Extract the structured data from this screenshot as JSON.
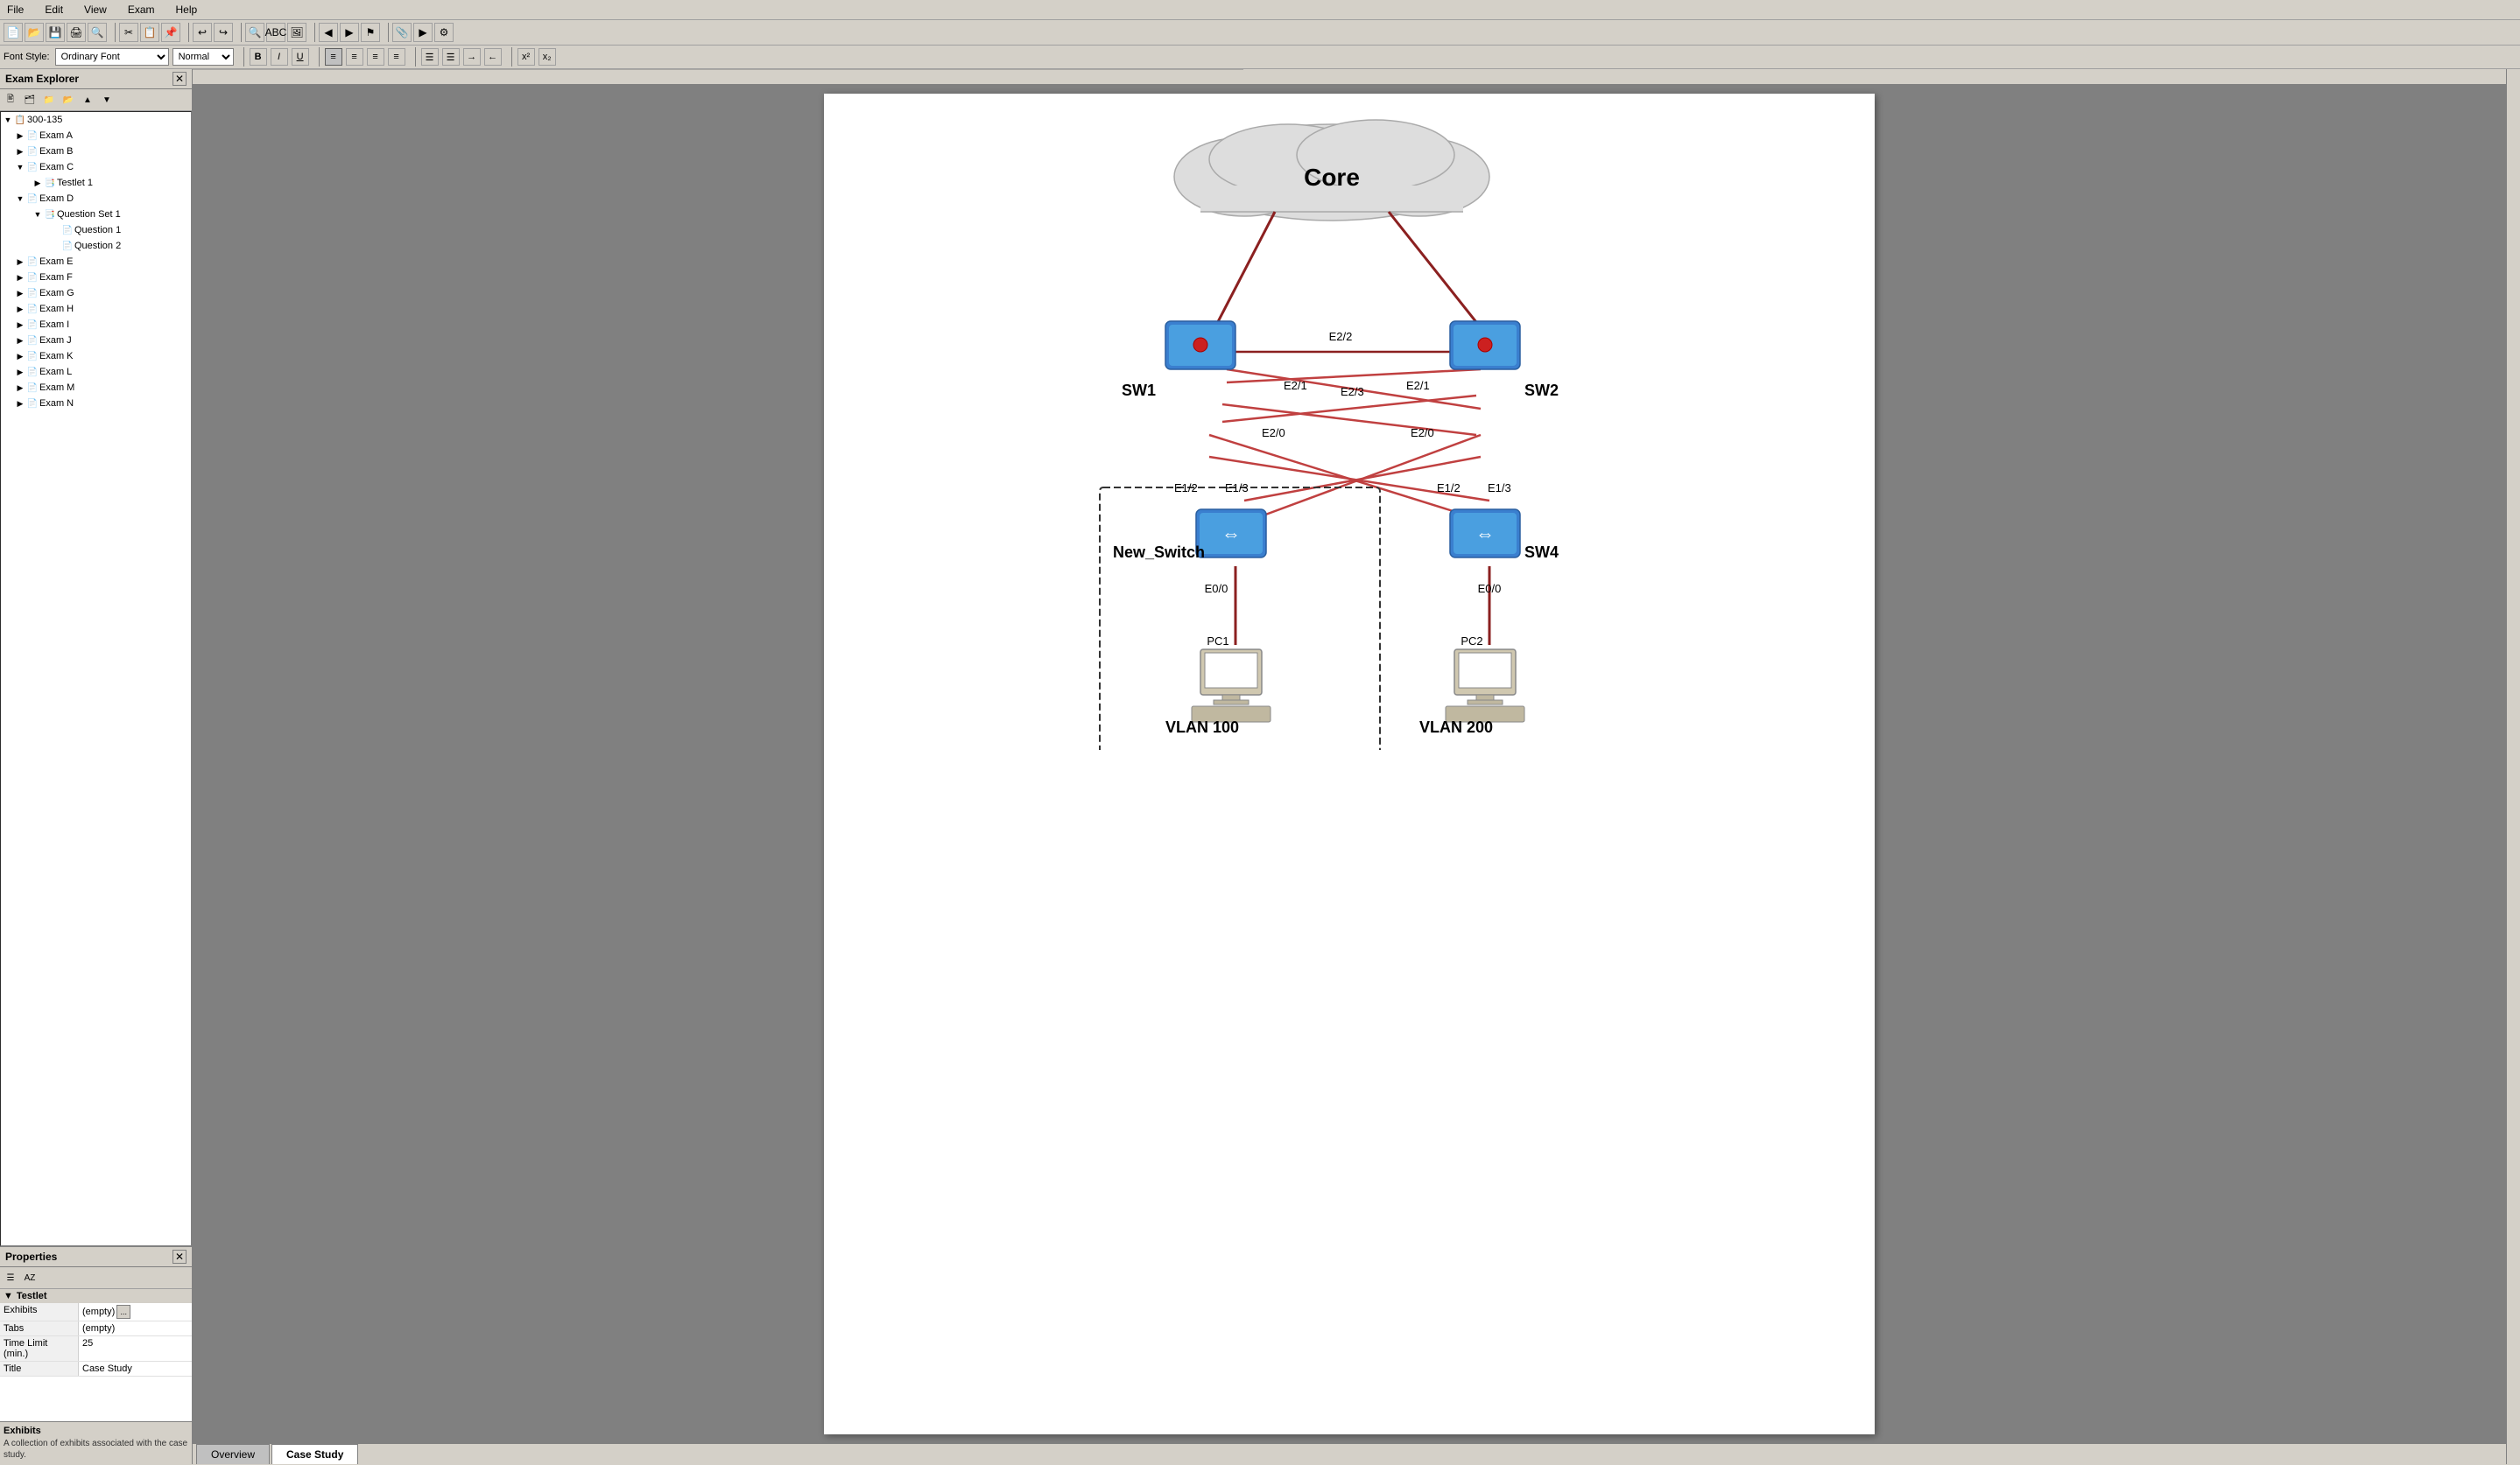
{
  "menu": {
    "items": [
      "File",
      "Edit",
      "View",
      "Exam",
      "Help"
    ]
  },
  "toolbar": {
    "buttons": [
      "new",
      "open",
      "save",
      "print",
      "preview",
      "cut",
      "copy",
      "paste",
      "undo",
      "redo",
      "find",
      "abc",
      "image",
      "left",
      "right",
      "flag",
      "attach",
      "media",
      "extra"
    ]
  },
  "format_toolbar": {
    "font_style_label": "Font Style:",
    "font_name": "Ordinary Font",
    "font_size": "Normal",
    "bold": "B",
    "italic": "I",
    "underline": "U",
    "align_left": "≡",
    "align_center": "≡",
    "align_right": "≡",
    "align_justify": "≡",
    "list_ordered": "list",
    "list_unordered": "list",
    "indent": "indent",
    "outdent": "outdent",
    "superscript": "x²",
    "subscript": "x₂"
  },
  "exam_explorer": {
    "title": "Exam Explorer",
    "root": "300-135",
    "items": [
      {
        "id": "exam-a",
        "label": "Exam A",
        "level": 1,
        "expandable": false
      },
      {
        "id": "exam-b",
        "label": "Exam B",
        "level": 1,
        "expandable": false
      },
      {
        "id": "exam-c",
        "label": "Exam C",
        "level": 1,
        "expandable": true,
        "children": [
          {
            "id": "testlet-1",
            "label": "Testlet 1",
            "level": 2
          }
        ]
      },
      {
        "id": "exam-d",
        "label": "Exam D",
        "level": 1,
        "expandable": true,
        "children": [
          {
            "id": "question-set-1",
            "label": "Question Set 1",
            "level": 2,
            "children": [
              {
                "id": "question-1",
                "label": "Question 1",
                "level": 3
              },
              {
                "id": "question-2",
                "label": "Question 2",
                "level": 3
              }
            ]
          }
        ]
      },
      {
        "id": "exam-e",
        "label": "Exam E",
        "level": 1
      },
      {
        "id": "exam-f",
        "label": "Exam F",
        "level": 1
      },
      {
        "id": "exam-g",
        "label": "Exam G",
        "level": 1
      },
      {
        "id": "exam-h",
        "label": "Exam H",
        "level": 1
      },
      {
        "id": "exam-i",
        "label": "Exam I",
        "level": 1
      },
      {
        "id": "exam-j",
        "label": "Exam J",
        "level": 1
      },
      {
        "id": "exam-k",
        "label": "Exam K",
        "level": 1
      },
      {
        "id": "exam-l",
        "label": "Exam L",
        "level": 1
      },
      {
        "id": "exam-m",
        "label": "Exam M",
        "level": 1
      },
      {
        "id": "exam-n",
        "label": "Exam N",
        "level": 1
      }
    ]
  },
  "properties": {
    "title": "Properties",
    "section": "Testlet",
    "rows": [
      {
        "key": "Exhibits",
        "value": "(empty)",
        "has_button": true
      },
      {
        "key": "Tabs",
        "value": "(empty)",
        "has_button": false
      },
      {
        "key": "Time Limit (min.)",
        "value": "25",
        "has_button": false
      },
      {
        "key": "Title",
        "value": "Case Study",
        "has_button": false
      }
    ]
  },
  "exhibits": {
    "title": "Exhibits",
    "description": "A collection of exhibits associated with the case study."
  },
  "diagram": {
    "core_label": "Core",
    "sw1_label": "SW1",
    "sw2_label": "SW2",
    "new_switch_label": "New_Switch",
    "sw4_label": "SW4",
    "vlan100_label": "VLAN 100",
    "vlan200_label": "VLAN 200",
    "pc1_label": "PC1",
    "pc2_label": "PC2",
    "ports": {
      "sw1_sw2_top": "E2/2",
      "sw1_e21": "E2/1",
      "sw2_e23": "E2/3",
      "sw2_e21": "E2/1",
      "sw1_e20": "E2/0",
      "sw2_e20": "E2/0",
      "new_e12": "E1/2",
      "new_e13": "E1/3",
      "sw4_e12": "E1/2",
      "sw4_e13": "E1/3",
      "new_e00": "E0/0",
      "sw4_e00": "E0/0"
    }
  },
  "tabs": [
    {
      "id": "overview",
      "label": "Overview",
      "active": false
    },
    {
      "id": "case-study",
      "label": "Case Study",
      "active": true
    }
  ]
}
